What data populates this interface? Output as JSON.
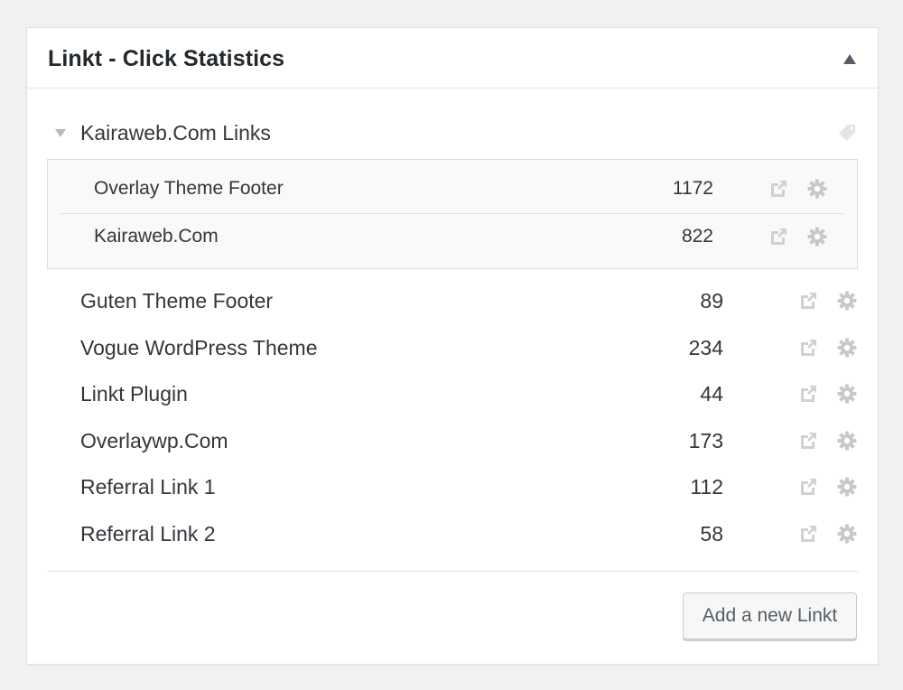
{
  "widget": {
    "title": "Linkt - Click Statistics",
    "collapse_icon": "triangle-up-icon"
  },
  "group": {
    "title": "Kairaweb.Com Links",
    "caret_icon": "triangle-down-icon",
    "tag_icon": "tag-icon",
    "items": [
      {
        "name": "Overlay Theme Footer",
        "count": "1172"
      },
      {
        "name": "Kairaweb.Com",
        "count": "822"
      }
    ]
  },
  "links": [
    {
      "name": "Guten Theme Footer",
      "count": "89"
    },
    {
      "name": "Vogue WordPress Theme",
      "count": "234"
    },
    {
      "name": "Linkt Plugin",
      "count": "44"
    },
    {
      "name": "Overlaywp.Com",
      "count": "173"
    },
    {
      "name": "Referral Link 1",
      "count": "112"
    },
    {
      "name": "Referral Link 2",
      "count": "58"
    }
  ],
  "row_icons": {
    "external": "external-link-icon",
    "settings": "gear-icon"
  },
  "footer": {
    "add_button_label": "Add a new Linkt"
  },
  "colors": {
    "icon_gray": "#c9cbcd",
    "text": "#32373c",
    "background": "#f1f1f1"
  }
}
